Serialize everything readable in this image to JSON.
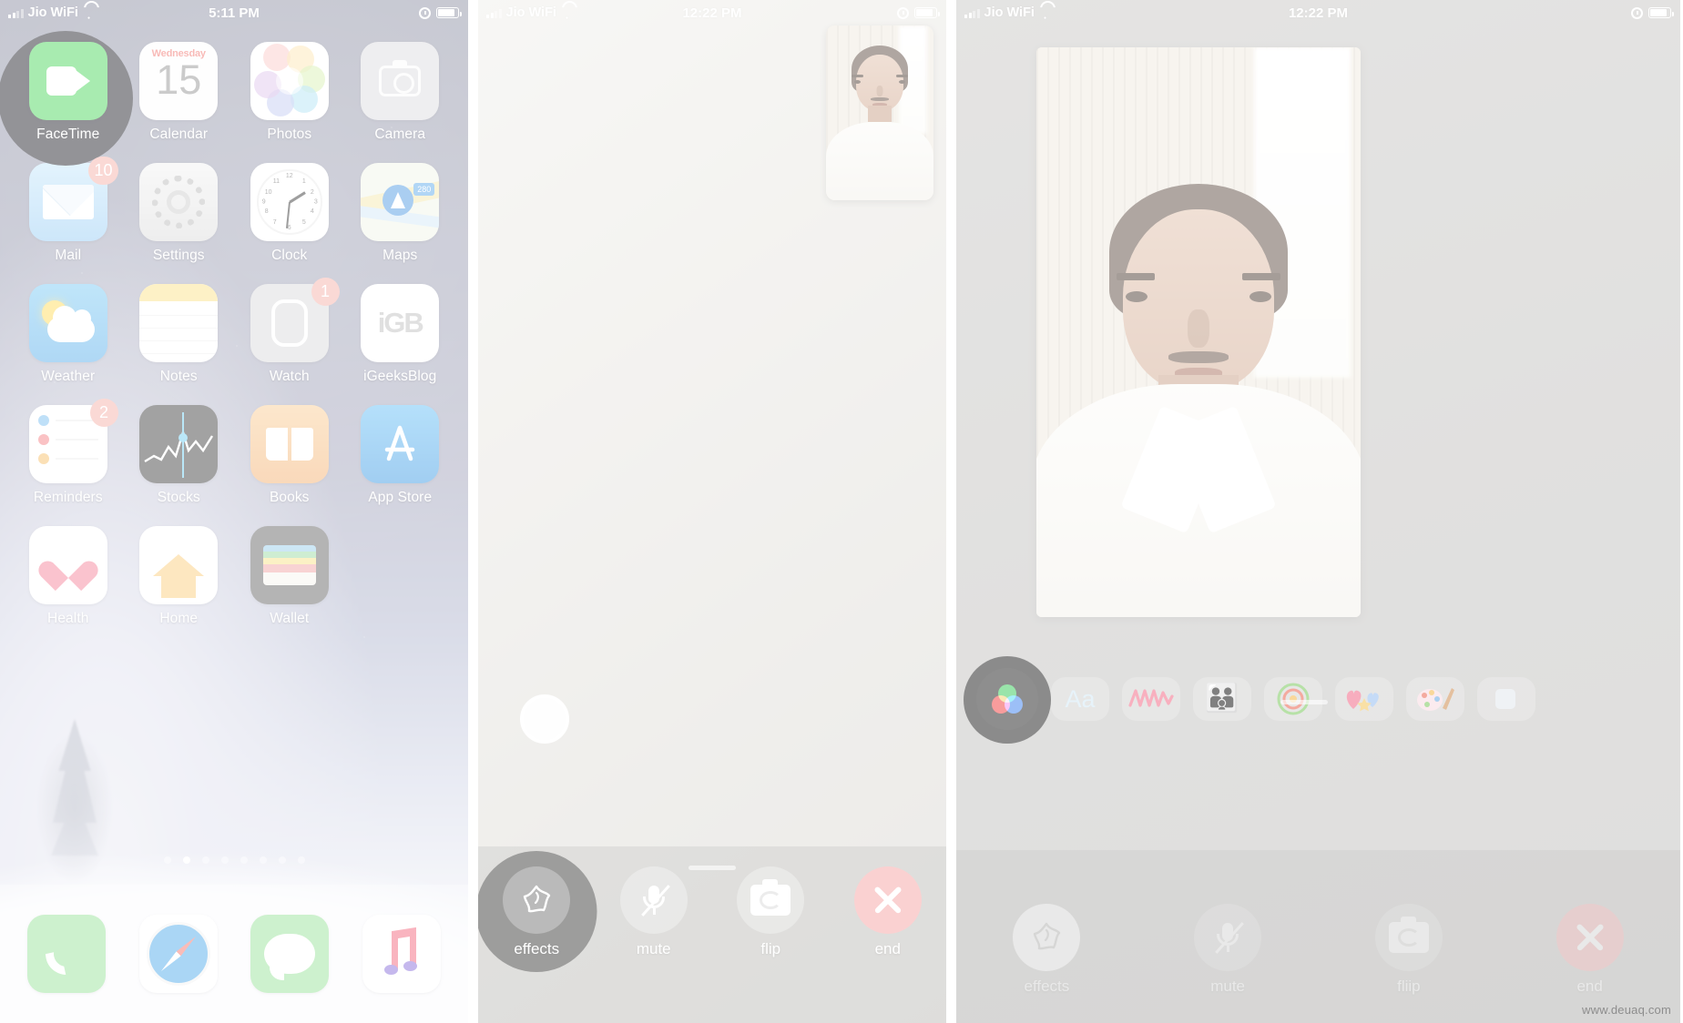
{
  "panels": {
    "home": {
      "status": {
        "carrier": "Jio WiFi",
        "time": "5:11 PM",
        "signal_icon": "signal-bars-icon",
        "wifi_icon": "wifi-icon",
        "alarm_icon": "alarm-clock-icon",
        "battery_icon": "battery-icon"
      },
      "apps": [
        {
          "label": "FaceTime",
          "icon": "facetime-icon",
          "badge": null,
          "highlighted": true
        },
        {
          "label": "Calendar",
          "icon": "calendar-icon",
          "badge": null,
          "day": "Wednesday",
          "date": "15"
        },
        {
          "label": "Photos",
          "icon": "photos-icon",
          "badge": null
        },
        {
          "label": "Camera",
          "icon": "camera-icon",
          "badge": null
        },
        {
          "label": "Mail",
          "icon": "mail-icon",
          "badge": "10"
        },
        {
          "label": "Settings",
          "icon": "settings-gear-icon",
          "badge": null
        },
        {
          "label": "Clock",
          "icon": "clock-icon",
          "badge": null
        },
        {
          "label": "Maps",
          "icon": "maps-icon",
          "badge": null,
          "road_label": "280"
        },
        {
          "label": "Weather",
          "icon": "weather-icon",
          "badge": null
        },
        {
          "label": "Notes",
          "icon": "notes-icon",
          "badge": null
        },
        {
          "label": "Watch",
          "icon": "watch-icon",
          "badge": "1"
        },
        {
          "label": "iGeeksBlog",
          "icon": "igeeksblog-icon",
          "badge": null,
          "mark": "iGB"
        },
        {
          "label": "Reminders",
          "icon": "reminders-icon",
          "badge": "2"
        },
        {
          "label": "Stocks",
          "icon": "stocks-icon",
          "badge": null
        },
        {
          "label": "Books",
          "icon": "books-icon",
          "badge": null
        },
        {
          "label": "App Store",
          "icon": "app-store-icon",
          "badge": null
        },
        {
          "label": "Health",
          "icon": "health-heart-icon",
          "badge": null
        },
        {
          "label": "Home",
          "icon": "home-house-icon",
          "badge": null
        },
        {
          "label": "Wallet",
          "icon": "wallet-icon",
          "badge": null
        }
      ],
      "page_dots": {
        "count": 8,
        "active_index": 1
      },
      "dock": [
        {
          "label": "Phone",
          "icon": "phone-icon"
        },
        {
          "label": "Safari",
          "icon": "safari-compass-icon"
        },
        {
          "label": "Messages",
          "icon": "messages-bubble-icon"
        },
        {
          "label": "Music",
          "icon": "music-note-icon"
        }
      ]
    },
    "call": {
      "status": {
        "carrier": "Jio WiFi",
        "time": "12:22 PM",
        "signal_icon": "signal-bars-icon",
        "wifi_icon": "wifi-icon",
        "alarm_icon": "alarm-clock-icon",
        "battery_icon": "battery-icon"
      },
      "shutter_label": "shutter-button",
      "controls": [
        {
          "label": "effects",
          "icon": "effects-star-icon",
          "state": "highlighted"
        },
        {
          "label": "mute",
          "icon": "mic-muted-icon",
          "state": "normal"
        },
        {
          "label": "flip",
          "icon": "camera-flip-icon",
          "state": "normal"
        },
        {
          "label": "end",
          "icon": "end-call-x-icon",
          "state": "danger"
        }
      ]
    },
    "effects": {
      "status": {
        "carrier": "Jio WiFi",
        "time": "12:22 PM",
        "signal_icon": "signal-bars-icon",
        "wifi_icon": "wifi-icon",
        "alarm_icon": "alarm-clock-icon",
        "battery_icon": "battery-icon"
      },
      "effects_tray": [
        {
          "label": "Filters",
          "icon": "rgb-filters-icon",
          "state": "highlighted"
        },
        {
          "label": "Aa",
          "icon": "text-aa-icon",
          "state": "normal"
        },
        {
          "label": "Shapes",
          "icon": "neon-scribble-icon",
          "state": "normal"
        },
        {
          "label": "Memoji",
          "icon": "memoji-faces-icon",
          "state": "normal"
        },
        {
          "label": "Stickers",
          "icon": "target-sticker-icon",
          "state": "normal"
        },
        {
          "label": "Emoji",
          "icon": "heart-sticker-icon",
          "state": "normal"
        },
        {
          "label": "Art",
          "icon": "palette-sticker-icon",
          "state": "normal"
        },
        {
          "label": "More",
          "icon": "more-sticker-icon",
          "state": "normal"
        }
      ],
      "controls": [
        {
          "label": "effects",
          "icon": "effects-star-icon",
          "state": "white"
        },
        {
          "label": "mute",
          "icon": "mic-muted-icon",
          "state": "normal"
        },
        {
          "label": "fliip",
          "icon": "camera-flip-icon",
          "state": "normal"
        },
        {
          "label": "end",
          "icon": "end-call-x-icon",
          "state": "danger"
        }
      ]
    }
  },
  "watermark": "www.deuaq.com",
  "colors": {
    "accent_green": "#3ad24b",
    "badge_red": "#f4a9a0",
    "end_red": "#f4a3a3",
    "highlight_dark": "#1d1d1d"
  }
}
